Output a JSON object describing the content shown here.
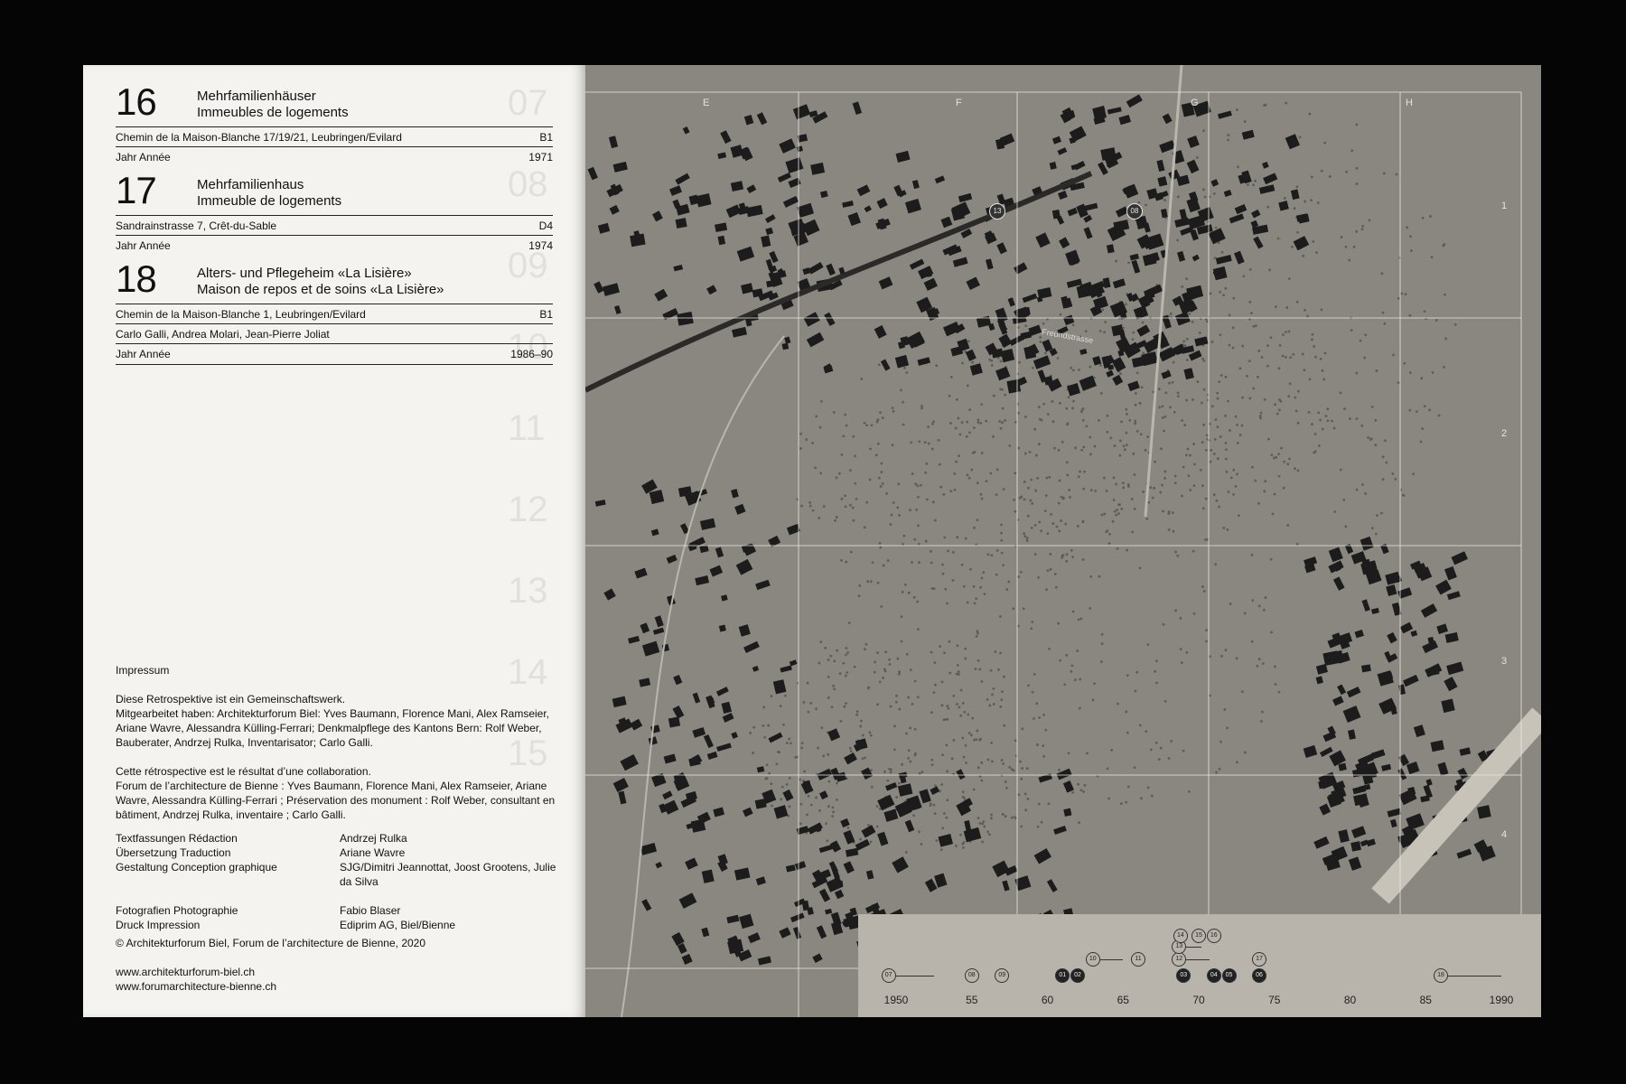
{
  "entries": [
    {
      "number": "16",
      "title_de": "Mehrfamilienhäuser",
      "title_fr": "Immeubles de logements",
      "address": "Chemin de la Maison-Blanche 17/19/21, Leubringen/Evilard",
      "grid": "B1",
      "architects": "",
      "year_label": "Jahr  Année",
      "year": "1971"
    },
    {
      "number": "17",
      "title_de": "Mehrfamilienhaus",
      "title_fr": "Immeuble de logements",
      "address": "Sandrainstrasse 7, Crêt-du-Sable",
      "grid": "D4",
      "architects": "",
      "year_label": "Jahr  Année",
      "year": "1974"
    },
    {
      "number": "18",
      "title_de": "Alters- und Pflegeheim «La Lisière»",
      "title_fr": "Maison de repos et de soins «La Lisière»",
      "address": "Chemin de la Maison-Blanche 1, Leubringen/Evilard",
      "grid": "B1",
      "architects": "Carlo Galli, Andrea Molari, Jean-Pierre Joliat",
      "year_label": "Jahr  Année",
      "year": "1986–90"
    }
  ],
  "impressum": {
    "heading": "Impressum",
    "de_1": "Diese Retrospektive ist ein Gemeinschaftswerk.",
    "de_2": "Mitgearbeitet haben: Architekturforum Biel: Yves Baumann, Florence Mani, Alex Ramseier, Ariane Wavre, Alessandra Külling-Ferrari; Denkmalpflege des Kantons Bern: Rolf Weber, Bauberater, Andrzej Rulka, Inventarisator; Carlo Galli.",
    "fr_1": "Cette rétrospective est le résultat d’une collaboration.",
    "fr_2": "Forum de l’architecture de Bienne : Yves Baumann, Florence Mani, Alex Ramseier, Ariane Wavre, Alessandra Külling-Ferrari ; Préservation des monument : Rolf Weber, consultant en bâtiment, Andrzej Rulka, inventaire ; Carlo Galli.",
    "credits": [
      {
        "role": "Textfassungen  Rédaction",
        "name": "Andrzej Rulka"
      },
      {
        "role": "Übersetzung  Traduction",
        "name": "Ariane Wavre"
      },
      {
        "role": "Gestaltung  Conception graphique",
        "name": "SJG/Dimitri Jeannottat, Joost Grootens, Julie da Silva"
      },
      {
        "role": "Fotografien  Photographie",
        "name": "Fabio Blaser"
      },
      {
        "role": "Druck  Impression",
        "name": "Ediprim AG, Biel/Bienne"
      }
    ],
    "copyright": "© Architekturforum Biel, Forum de l’architecture de Bienne, 2020",
    "url_1": "www.architekturforum-biel.ch",
    "url_2": "www.forumarchitecture-bienne.ch"
  },
  "map": {
    "columns": [
      "E",
      "F",
      "G",
      "H"
    ],
    "rows": [
      "1",
      "2",
      "3",
      "4"
    ],
    "markers": [
      "13",
      "08"
    ],
    "street": "Freundstrasse",
    "colors": {
      "paper": "#8a8781",
      "buildings": "#1c1c1c",
      "grid": "#e9e7e2",
      "timeline_bg": "#b8b4ab"
    }
  },
  "timeline": {
    "years": [
      "1950",
      "55",
      "60",
      "65",
      "70",
      "75",
      "80",
      "85",
      "1990"
    ],
    "year_values": [
      1950,
      1955,
      1960,
      1965,
      1970,
      1975,
      1980,
      1985,
      1990
    ],
    "dots": [
      {
        "id": "07",
        "year": 1949.5,
        "row": 0,
        "filled": false,
        "span": 3
      },
      {
        "id": "08",
        "year": 1955,
        "row": 0,
        "filled": false
      },
      {
        "id": "09",
        "year": 1957,
        "row": 0,
        "filled": false
      },
      {
        "id": "01",
        "year": 1961,
        "row": 0,
        "filled": true
      },
      {
        "id": "02",
        "year": 1962,
        "row": 0,
        "filled": true
      },
      {
        "id": "10",
        "year": 1963,
        "row": 1,
        "filled": false,
        "span": 2
      },
      {
        "id": "11",
        "year": 1966,
        "row": 1,
        "filled": false
      },
      {
        "id": "03",
        "year": 1969,
        "row": 0,
        "filled": true
      },
      {
        "id": "04",
        "year": 1971,
        "row": 0,
        "filled": true
      },
      {
        "id": "05",
        "year": 1972,
        "row": 0,
        "filled": true
      },
      {
        "id": "06",
        "year": 1974,
        "row": 0,
        "filled": true
      },
      {
        "id": "12",
        "year": 1968.7,
        "row": 1,
        "filled": false,
        "span": 2
      },
      {
        "id": "17",
        "year": 1974,
        "row": 1,
        "filled": false
      },
      {
        "id": "13",
        "year": 1968.7,
        "row": 2,
        "filled": false,
        "span": 1.5
      },
      {
        "id": "14",
        "year": 1968.8,
        "row": 3,
        "filled": false
      },
      {
        "id": "15",
        "year": 1970,
        "row": 3,
        "filled": false
      },
      {
        "id": "16",
        "year": 1971,
        "row": 3,
        "filled": false
      },
      {
        "id": "18",
        "year": 1986,
        "row": 0,
        "filled": false,
        "span": 4
      }
    ]
  }
}
